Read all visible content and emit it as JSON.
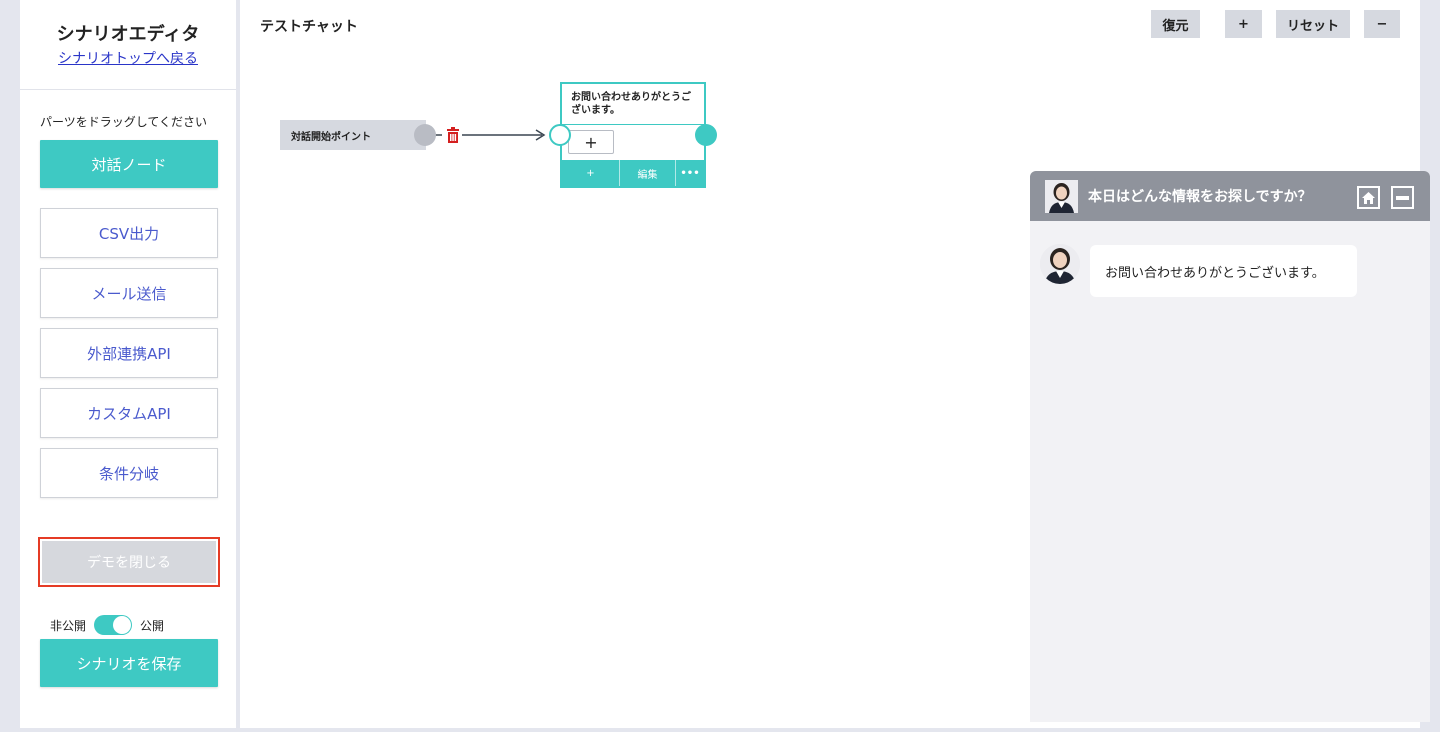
{
  "sidebar": {
    "title": "シナリオエディタ",
    "back_link": "シナリオトップへ戻る",
    "hint": "パーツをドラッグしてください",
    "dialog_node": "対話ノード",
    "parts": [
      "CSV出力",
      "メール送信",
      "外部連携API",
      "カスタムAPI",
      "条件分岐"
    ],
    "demo_close": "デモを閉じる",
    "toggle_off": "非公開",
    "toggle_on": "公開",
    "toggle_state": "公開",
    "save": "シナリオを保存"
  },
  "canvas": {
    "title": "テストチャット",
    "toolbar": {
      "restore": "復元",
      "zoom_in": "+",
      "reset": "リセット",
      "zoom_out": "−"
    },
    "start_node": "対話開始ポイント",
    "node": {
      "text": "お問い合わせありがとうございます。",
      "add_choice": "+",
      "footer_add": "+",
      "footer_edit": "編集",
      "footer_more": "•••"
    }
  },
  "chat": {
    "header": "本日はどんな情報をお探しですか？",
    "message": "お問い合わせありがとうございます。"
  },
  "colors": {
    "accent": "#3ec9c3",
    "link": "#2a35c8",
    "danger": "#e53b25",
    "chat_header": "#8f939c"
  }
}
